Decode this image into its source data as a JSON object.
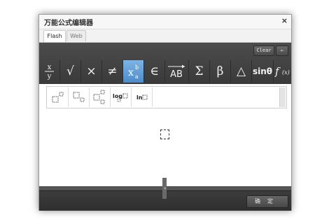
{
  "dialog": {
    "title": "万能公式编辑器",
    "close_glyph": "×"
  },
  "tabs": [
    {
      "label": "Flash"
    },
    {
      "label": "Web"
    }
  ],
  "toolbar": {
    "clear_label": "Clear",
    "back_label": "←"
  },
  "symbols": [
    {
      "name": "fraction",
      "label": ""
    },
    {
      "name": "sqrt",
      "label": "√"
    },
    {
      "name": "times",
      "label": "×"
    },
    {
      "name": "not-equal",
      "label": "≠"
    },
    {
      "name": "subsup",
      "label": ""
    },
    {
      "name": "element-of",
      "label": "∈"
    },
    {
      "name": "vector",
      "label": ""
    },
    {
      "name": "sum",
      "label": "Σ"
    },
    {
      "name": "beta",
      "label": "β"
    },
    {
      "name": "triangle",
      "label": "△"
    },
    {
      "name": "sin-theta",
      "label": "sinθ"
    },
    {
      "name": "function",
      "label": ""
    }
  ],
  "symbol_glyphs": {
    "fraction_num": "x",
    "fraction_den": "y",
    "subsup_base": "x",
    "subsup_sup": "b",
    "subsup_sub": "a",
    "vector_text": "AB",
    "function_f": "f",
    "function_arg": "(x)"
  },
  "templates": {
    "log_label": "log",
    "ln_label": "ln"
  },
  "footer": {
    "ok_label": "确定",
    "collapse_glyph": "«"
  }
}
